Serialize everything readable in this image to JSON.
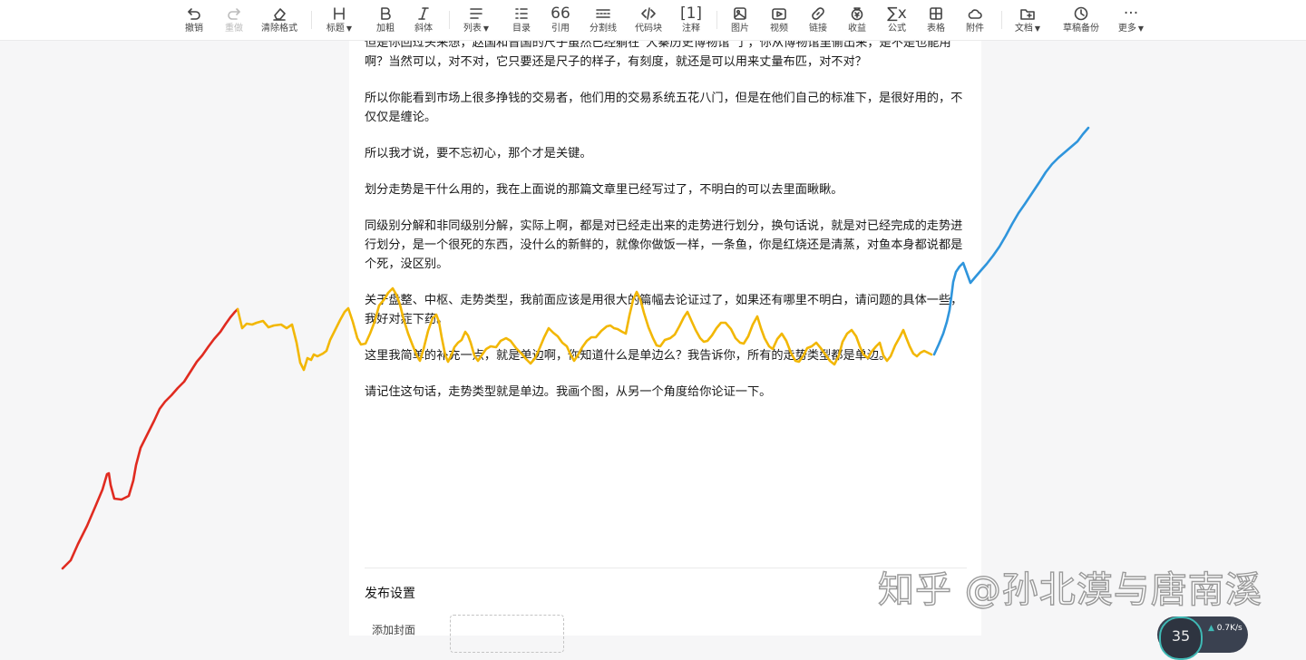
{
  "toolbar": {
    "undo": "撤销",
    "redo": "重做",
    "clear_format": "清除格式",
    "heading": "标题",
    "bold": "加粗",
    "italic": "斜体",
    "list": "列表",
    "toc": "目录",
    "quote": "引用",
    "divider": "分割线",
    "code_block": "代码块",
    "annotation": "注释",
    "image": "图片",
    "video": "视频",
    "link": "链接",
    "earnings": "收益",
    "formula": "公式",
    "table": "表格",
    "attachment": "附件",
    "document": "文档",
    "draft_backup": "草稿备份",
    "more": "更多"
  },
  "article": {
    "paragraphs": [
      "但是你回过头来想，赵国和晋国的尺子虽然已经躺在“大秦历史博物馆”了，你从博物馆里偷出来，是不是也能用啊？当然可以，对不对，它只要还是尺子的样子，有刻度，就还是可以用来丈量布匹，对不对？",
      "所以你能看到市场上很多挣钱的交易者，他们用的交易系统五花八门，但是在他们自己的标准下，是很好用的，不仅仅是缠论。",
      "所以我才说，要不忘初心，那个才是关键。",
      "划分走势是干什么用的，我在上面说的那篇文章里已经写过了，不明白的可以去里面瞅瞅。",
      "同级别分解和非同级别分解，实际上啊，都是对已经走出来的走势进行划分，换句话说，就是对已经完成的走势进行划分，是一个很死的东西，没什么的新鲜的，就像你做饭一样，一条鱼，你是红烧还是清蒸，对鱼本身都说都是个死，没区别。",
      "关于盘整、中枢、走势类型，我前面应该是用很大的篇幅去论证过了，如果还有哪里不明白，请问题的具体一些，我好对症下药。",
      "这里我简单的补充一点，就是单边啊，你知道什么是单边么？我告诉你，所有的走势类型都是单边。",
      "请记住这句话，走势类型就是单边。我画个图，从另一个角度给你论证一下。"
    ]
  },
  "publish": {
    "title": "发布设置",
    "add_cover": "添加封面"
  },
  "watermark": "知乎 @孙北漠与唐南溪",
  "speed_widget": {
    "percent": "35",
    "rate": "0.7",
    "unit": "K/s"
  },
  "drawing_colors": {
    "red": "#e02b20",
    "yellow": "#f2b705",
    "blue": "#2f95dc"
  }
}
